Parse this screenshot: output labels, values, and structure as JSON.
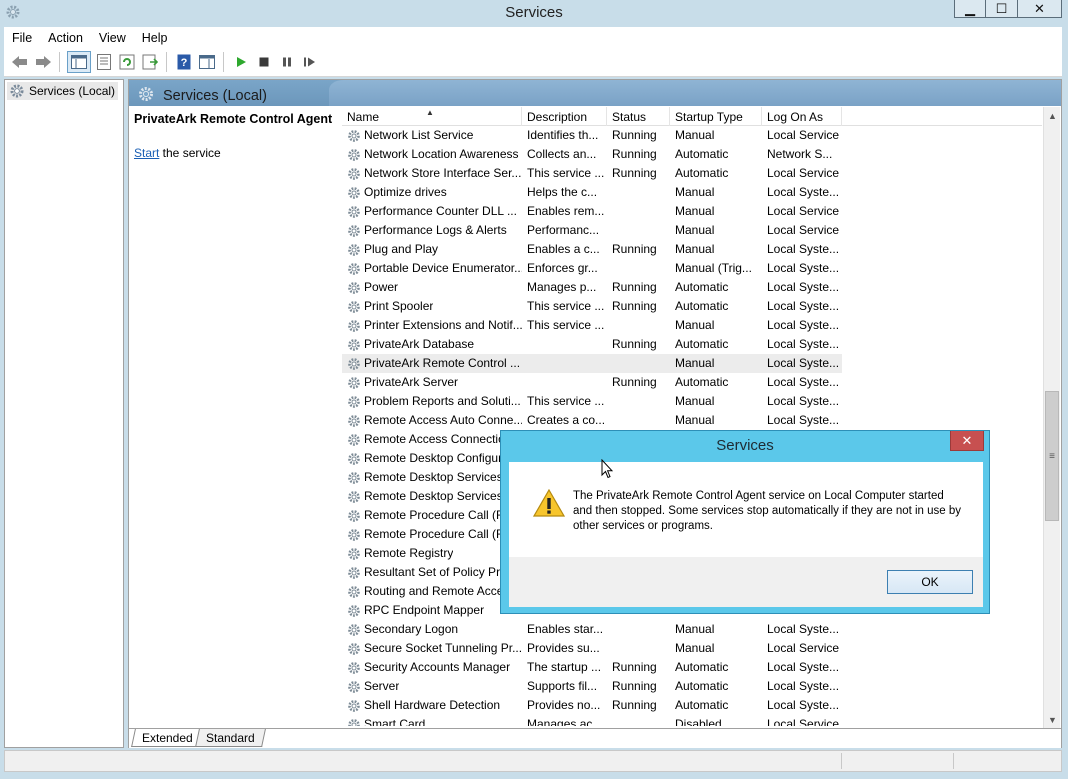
{
  "window": {
    "title": "Services"
  },
  "menu": [
    "File",
    "Action",
    "View",
    "Help"
  ],
  "tree": {
    "root_label": "Services (Local)"
  },
  "panel": {
    "header_title": "Services (Local)",
    "selected_service": "PrivateArk Remote Control Agent",
    "start_link": "Start",
    "start_suffix": " the service"
  },
  "table": {
    "columns": [
      "Name",
      "Description",
      "Status",
      "Startup Type",
      "Log On As"
    ],
    "rows": [
      [
        "Network List Service",
        "Identifies th...",
        "Running",
        "Manual",
        "Local Service"
      ],
      [
        "Network Location Awareness",
        "Collects an...",
        "Running",
        "Automatic",
        "Network S..."
      ],
      [
        "Network Store Interface Ser...",
        "This service ...",
        "Running",
        "Automatic",
        "Local Service"
      ],
      [
        "Optimize drives",
        "Helps the c...",
        "",
        "Manual",
        "Local Syste..."
      ],
      [
        "Performance Counter DLL ...",
        "Enables rem...",
        "",
        "Manual",
        "Local Service"
      ],
      [
        "Performance Logs & Alerts",
        "Performanc...",
        "",
        "Manual",
        "Local Service"
      ],
      [
        "Plug and Play",
        "Enables a c...",
        "Running",
        "Manual",
        "Local Syste..."
      ],
      [
        "Portable Device Enumerator...",
        "Enforces gr...",
        "",
        "Manual (Trig...",
        "Local Syste..."
      ],
      [
        "Power",
        "Manages p...",
        "Running",
        "Automatic",
        "Local Syste..."
      ],
      [
        "Print Spooler",
        "This service ...",
        "Running",
        "Automatic",
        "Local Syste..."
      ],
      [
        "Printer Extensions and Notif...",
        "This service ...",
        "",
        "Manual",
        "Local Syste..."
      ],
      [
        "PrivateArk Database",
        "",
        "Running",
        "Automatic",
        "Local Syste..."
      ],
      [
        "PrivateArk Remote Control ...",
        "",
        "",
        "Manual",
        "Local Syste..."
      ],
      [
        "PrivateArk Server",
        "",
        "Running",
        "Automatic",
        "Local Syste..."
      ],
      [
        "Problem Reports and Soluti...",
        "This service ...",
        "",
        "Manual",
        "Local Syste..."
      ],
      [
        "Remote Access Auto Conne...",
        "Creates a co...",
        "",
        "Manual",
        "Local Syste..."
      ],
      [
        "Remote Access Connection",
        "",
        "",
        "",
        ""
      ],
      [
        "Remote Desktop Configur",
        "",
        "",
        "",
        ""
      ],
      [
        "Remote Desktop Services",
        "",
        "",
        "",
        ""
      ],
      [
        "Remote Desktop Services U",
        "",
        "",
        "",
        ""
      ],
      [
        "Remote Procedure Call (RI",
        "",
        "",
        "",
        ""
      ],
      [
        "Remote Procedure Call (RI",
        "",
        "",
        "",
        ""
      ],
      [
        "Remote Registry",
        "",
        "",
        "",
        ""
      ],
      [
        "Resultant Set of Policy Pro",
        "",
        "",
        "",
        ""
      ],
      [
        "Routing and Remote Acce",
        "",
        "",
        "",
        ""
      ],
      [
        "RPC Endpoint Mapper",
        "",
        "",
        "",
        ""
      ],
      [
        "Secondary Logon",
        "Enables star...",
        "",
        "Manual",
        "Local Syste..."
      ],
      [
        "Secure Socket Tunneling Pr...",
        "Provides su...",
        "",
        "Manual",
        "Local Service"
      ],
      [
        "Security Accounts Manager",
        "The startup ...",
        "Running",
        "Automatic",
        "Local Syste..."
      ],
      [
        "Server",
        "Supports fil...",
        "Running",
        "Automatic",
        "Local Syste..."
      ],
      [
        "Shell Hardware Detection",
        "Provides no...",
        "Running",
        "Automatic",
        "Local Syste..."
      ],
      [
        "Smart Card",
        "Manages ac...",
        "",
        "Disabled",
        "Local Service"
      ]
    ],
    "highlight_index": 12
  },
  "tabs": [
    "Extended",
    "Standard"
  ],
  "dialog": {
    "title": "Services",
    "message": "The PrivateArk Remote Control Agent service on Local Computer started and then stopped. Some services stop automatically if they are not in use by other services or programs.",
    "ok_label": "OK",
    "icon": "warning-icon"
  },
  "colors": {
    "dialog_frame": "#5bc8ea",
    "close_button": "#c75050",
    "link": "#1a5fb4"
  }
}
